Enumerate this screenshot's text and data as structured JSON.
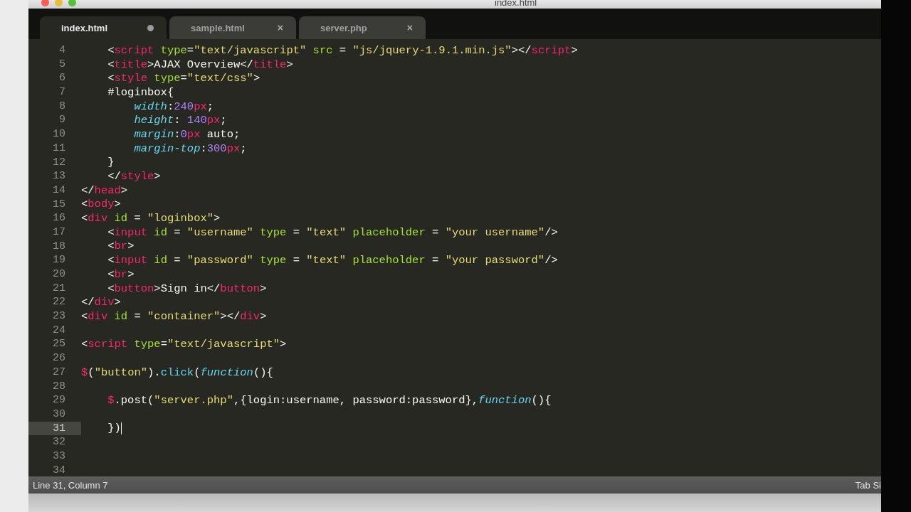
{
  "window": {
    "title": "index.html"
  },
  "tabs": [
    {
      "label": "index.html",
      "selected": true,
      "modified": true
    },
    {
      "label": "sample.html",
      "selected": false,
      "modified": false,
      "close": "×"
    },
    {
      "label": "server.php",
      "selected": false,
      "modified": false,
      "close": "×"
    }
  ],
  "editor": {
    "lines": [
      {
        "number": "4",
        "current": false,
        "tokens": [
          {
            "kind": "plain",
            "text": "    <"
          },
          {
            "kind": "tag",
            "text": "script"
          },
          {
            "kind": "attr",
            "text": " type"
          },
          {
            "kind": "plain",
            "text": "="
          },
          {
            "kind": "string",
            "text": "\"text/javascript\""
          },
          {
            "kind": "attr",
            "text": " src"
          },
          {
            "kind": "plain",
            "text": " = "
          },
          {
            "kind": "string",
            "text": "\"js/jquery-1.9.1.min.js\""
          },
          {
            "kind": "plain",
            "text": "></"
          },
          {
            "kind": "tag",
            "text": "script"
          },
          {
            "kind": "plain",
            "text": ">"
          }
        ]
      },
      {
        "number": "5",
        "current": false,
        "tokens": [
          {
            "kind": "plain",
            "text": "    <"
          },
          {
            "kind": "tag",
            "text": "title"
          },
          {
            "kind": "plain",
            "text": ">AJAX Overview</"
          },
          {
            "kind": "tag",
            "text": "title"
          },
          {
            "kind": "plain",
            "text": ">"
          }
        ]
      },
      {
        "number": "6",
        "current": false,
        "tokens": [
          {
            "kind": "plain",
            "text": "    <"
          },
          {
            "kind": "tag",
            "text": "style"
          },
          {
            "kind": "attr",
            "text": " type"
          },
          {
            "kind": "plain",
            "text": "="
          },
          {
            "kind": "string",
            "text": "\"text/css\""
          },
          {
            "kind": "plain",
            "text": ">"
          }
        ]
      },
      {
        "number": "7",
        "current": false,
        "tokens": [
          {
            "kind": "plain",
            "text": "    #loginbox{"
          }
        ]
      },
      {
        "number": "8",
        "current": false,
        "tokens": [
          {
            "kind": "property",
            "text": "        width"
          },
          {
            "kind": "plain",
            "text": ":"
          },
          {
            "kind": "number",
            "text": "240"
          },
          {
            "kind": "tag",
            "text": "px"
          },
          {
            "kind": "plain",
            "text": ";"
          }
        ]
      },
      {
        "number": "9",
        "current": false,
        "tokens": [
          {
            "kind": "property",
            "text": "        height"
          },
          {
            "kind": "plain",
            "text": ": "
          },
          {
            "kind": "number",
            "text": "140"
          },
          {
            "kind": "tag",
            "text": "px"
          },
          {
            "kind": "plain",
            "text": ";"
          }
        ]
      },
      {
        "number": "10",
        "current": false,
        "tokens": [
          {
            "kind": "property",
            "text": "        margin"
          },
          {
            "kind": "plain",
            "text": ":"
          },
          {
            "kind": "number",
            "text": "0"
          },
          {
            "kind": "tag",
            "text": "px"
          },
          {
            "kind": "plain",
            "text": " auto;"
          }
        ]
      },
      {
        "number": "11",
        "current": false,
        "tokens": [
          {
            "kind": "property",
            "text": "        margin-top"
          },
          {
            "kind": "plain",
            "text": ":"
          },
          {
            "kind": "number",
            "text": "300"
          },
          {
            "kind": "tag",
            "text": "px"
          },
          {
            "kind": "plain",
            "text": ";"
          }
        ]
      },
      {
        "number": "12",
        "current": false,
        "tokens": [
          {
            "kind": "plain",
            "text": "    }"
          }
        ]
      },
      {
        "number": "13",
        "current": false,
        "tokens": [
          {
            "kind": "plain",
            "text": "    </"
          },
          {
            "kind": "tag",
            "text": "style"
          },
          {
            "kind": "plain",
            "text": ">"
          }
        ]
      },
      {
        "number": "14",
        "current": false,
        "tokens": [
          {
            "kind": "plain",
            "text": "</"
          },
          {
            "kind": "tag",
            "text": "head"
          },
          {
            "kind": "plain",
            "text": ">"
          }
        ]
      },
      {
        "number": "15",
        "current": false,
        "tokens": [
          {
            "kind": "plain",
            "text": "<"
          },
          {
            "kind": "tag",
            "text": "body"
          },
          {
            "kind": "plain",
            "text": ">"
          }
        ]
      },
      {
        "number": "16",
        "current": false,
        "tokens": [
          {
            "kind": "plain",
            "text": "<"
          },
          {
            "kind": "tag",
            "text": "div"
          },
          {
            "kind": "attr",
            "text": " id"
          },
          {
            "kind": "plain",
            "text": " = "
          },
          {
            "kind": "string",
            "text": "\"loginbox\""
          },
          {
            "kind": "plain",
            "text": ">"
          }
        ]
      },
      {
        "number": "17",
        "current": false,
        "tokens": [
          {
            "kind": "plain",
            "text": "    <"
          },
          {
            "kind": "tag",
            "text": "input"
          },
          {
            "kind": "attr",
            "text": " id"
          },
          {
            "kind": "plain",
            "text": " = "
          },
          {
            "kind": "string",
            "text": "\"username\""
          },
          {
            "kind": "attr",
            "text": " type"
          },
          {
            "kind": "plain",
            "text": " = "
          },
          {
            "kind": "string",
            "text": "\"text\""
          },
          {
            "kind": "attr",
            "text": " placeholder"
          },
          {
            "kind": "plain",
            "text": " = "
          },
          {
            "kind": "string",
            "text": "\"your username\""
          },
          {
            "kind": "plain",
            "text": "/>"
          }
        ]
      },
      {
        "number": "18",
        "current": false,
        "tokens": [
          {
            "kind": "plain",
            "text": "    <"
          },
          {
            "kind": "tag",
            "text": "br"
          },
          {
            "kind": "plain",
            "text": ">"
          }
        ]
      },
      {
        "number": "19",
        "current": false,
        "tokens": [
          {
            "kind": "plain",
            "text": "    <"
          },
          {
            "kind": "tag",
            "text": "input"
          },
          {
            "kind": "attr",
            "text": " id"
          },
          {
            "kind": "plain",
            "text": " = "
          },
          {
            "kind": "string",
            "text": "\"password\""
          },
          {
            "kind": "attr",
            "text": " type"
          },
          {
            "kind": "plain",
            "text": " = "
          },
          {
            "kind": "string",
            "text": "\"text\""
          },
          {
            "kind": "attr",
            "text": " placeholder"
          },
          {
            "kind": "plain",
            "text": " = "
          },
          {
            "kind": "string",
            "text": "\"your password\""
          },
          {
            "kind": "plain",
            "text": "/>"
          }
        ]
      },
      {
        "number": "20",
        "current": false,
        "tokens": [
          {
            "kind": "plain",
            "text": "    <"
          },
          {
            "kind": "tag",
            "text": "br"
          },
          {
            "kind": "plain",
            "text": ">"
          }
        ]
      },
      {
        "number": "21",
        "current": false,
        "tokens": [
          {
            "kind": "plain",
            "text": "    <"
          },
          {
            "kind": "tag",
            "text": "button"
          },
          {
            "kind": "plain",
            "text": ">Sign in</"
          },
          {
            "kind": "tag",
            "text": "button"
          },
          {
            "kind": "plain",
            "text": ">"
          }
        ]
      },
      {
        "number": "22",
        "current": false,
        "tokens": [
          {
            "kind": "plain",
            "text": "</"
          },
          {
            "kind": "tag",
            "text": "div"
          },
          {
            "kind": "plain",
            "text": ">"
          }
        ]
      },
      {
        "number": "23",
        "current": false,
        "tokens": [
          {
            "kind": "plain",
            "text": "<"
          },
          {
            "kind": "tag",
            "text": "div"
          },
          {
            "kind": "attr",
            "text": " id"
          },
          {
            "kind": "plain",
            "text": " = "
          },
          {
            "kind": "string",
            "text": "\"container\""
          },
          {
            "kind": "plain",
            "text": "></"
          },
          {
            "kind": "tag",
            "text": "div"
          },
          {
            "kind": "plain",
            "text": ">"
          }
        ]
      },
      {
        "number": "24",
        "current": false
      },
      {
        "number": "25",
        "current": false,
        "tokens": [
          {
            "kind": "plain",
            "text": "<"
          },
          {
            "kind": "tag",
            "text": "script"
          },
          {
            "kind": "attr",
            "text": " type"
          },
          {
            "kind": "plain",
            "text": "="
          },
          {
            "kind": "string",
            "text": "\"text/javascript\""
          },
          {
            "kind": "plain",
            "text": ">"
          }
        ]
      },
      {
        "number": "26",
        "current": false
      },
      {
        "number": "27",
        "current": false,
        "tokens": [
          {
            "kind": "tag",
            "text": "$"
          },
          {
            "kind": "plain",
            "text": "("
          },
          {
            "kind": "string",
            "text": "\"button\""
          },
          {
            "kind": "plain",
            "text": ")."
          },
          {
            "kind": "function",
            "text": "click"
          },
          {
            "kind": "plain",
            "text": "("
          },
          {
            "kind": "property",
            "text": "function"
          },
          {
            "kind": "plain",
            "text": "(){"
          }
        ]
      },
      {
        "number": "28",
        "current": false
      },
      {
        "number": "29",
        "current": false,
        "tokens": [
          {
            "kind": "tag",
            "text": "    $"
          },
          {
            "kind": "plain",
            "text": ".post("
          },
          {
            "kind": "string",
            "text": "\"server.php\""
          },
          {
            "kind": "plain",
            "text": ",{login:username, password:password},"
          },
          {
            "kind": "property",
            "text": "function"
          },
          {
            "kind": "plain",
            "text": "(){"
          }
        ]
      },
      {
        "number": "30",
        "current": false
      },
      {
        "number": "31",
        "current": true,
        "tokens": [
          {
            "kind": "plain",
            "text": "    })"
          }
        ]
      },
      {
        "number": "32",
        "current": false
      },
      {
        "number": "33",
        "current": false
      },
      {
        "number": "34",
        "current": false
      }
    ]
  },
  "status_bar": {
    "position": "Line 31, Column 7",
    "indent": "Tab Si"
  }
}
